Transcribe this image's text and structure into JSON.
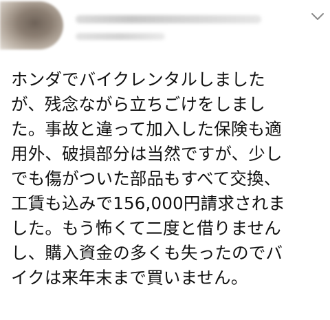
{
  "tweet": {
    "lines": [
      "ホンダでバイクレンタルしました",
      "が、残念ながら立ちごけをしまし",
      "た。事故と違って加入した保険も適",
      "用外、破損部分は当然ですが、少し",
      "でも傷がついた部品もすべて交換、",
      "工賃も込みで156,000円請求されま",
      "した。もう怖くて二度と借りません",
      "し、購入資金の多くも失ったのでバ",
      "イクは来年末まで買いません。"
    ],
    "menu_icon": "chevron-down-icon"
  }
}
